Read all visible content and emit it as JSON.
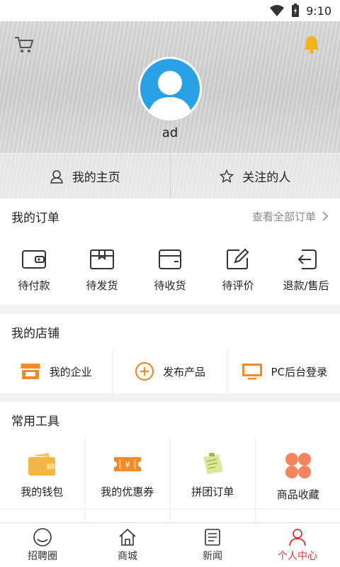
{
  "status": {
    "time": "9:10"
  },
  "profile": {
    "username": "ad"
  },
  "hero_tabs": [
    {
      "label": "我的主页",
      "icon": "person-icon"
    },
    {
      "label": "关注的人",
      "icon": "star-icon"
    }
  ],
  "orders": {
    "title": "我的订单",
    "view_all": "查看全部订单",
    "items": [
      {
        "label": "待付款",
        "icon": "wallet-icon"
      },
      {
        "label": "待发货",
        "icon": "box-icon"
      },
      {
        "label": "待收货",
        "icon": "receive-icon"
      },
      {
        "label": "待评价",
        "icon": "edit-icon"
      },
      {
        "label": "退款/售后",
        "icon": "return-icon"
      }
    ]
  },
  "shop": {
    "title": "我的店铺",
    "items": [
      {
        "label": "我的企业",
        "icon": "store-icon",
        "color": "#f08a2a"
      },
      {
        "label": "发布产品",
        "icon": "add-circle-icon",
        "color": "#f08a2a"
      },
      {
        "label": "PC后台登录",
        "icon": "monitor-icon",
        "color": "#f08a2a"
      }
    ]
  },
  "tools": {
    "title": "常用工具",
    "items": [
      {
        "label": "我的钱包",
        "icon": "wallet-fill-icon",
        "color": "#f4b547"
      },
      {
        "label": "我的优惠券",
        "icon": "coupon-icon",
        "color": "#f08a2a"
      },
      {
        "label": "拼团订单",
        "icon": "group-order-icon",
        "color": "#c9d96b"
      },
      {
        "label": "商品收藏",
        "icon": "clover-icon",
        "color": "#f2845f"
      }
    ]
  },
  "tabbar": [
    {
      "label": "招聘圈",
      "icon": "smile-icon"
    },
    {
      "label": "商城",
      "icon": "home-icon"
    },
    {
      "label": "新闻",
      "icon": "news-icon"
    },
    {
      "label": "个人中心",
      "icon": "user-icon",
      "active": true
    }
  ],
  "colors": {
    "accent": "#d9342b",
    "orange": "#f08a2a",
    "avatar_blue": "#2aa0e6"
  }
}
